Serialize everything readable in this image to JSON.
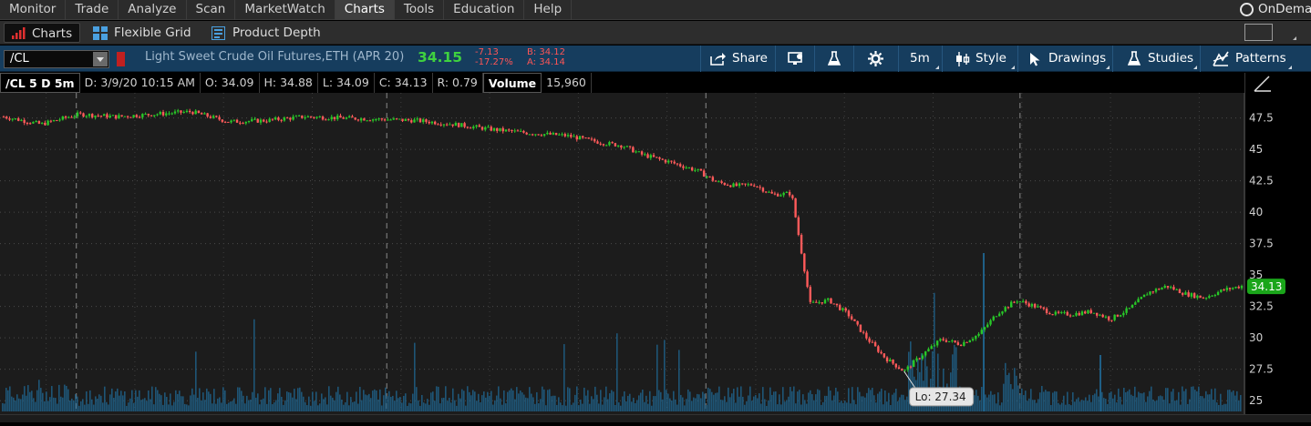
{
  "menubar": {
    "items": [
      "Monitor",
      "Trade",
      "Analyze",
      "Scan",
      "MarketWatch",
      "Charts",
      "Tools",
      "Education",
      "Help"
    ],
    "active": "Charts",
    "ondemand": "OnDemand"
  },
  "subbar": {
    "charts": "Charts",
    "flexible_grid": "Flexible Grid",
    "product_depth": "Product Depth"
  },
  "toolbar": {
    "symbol": "/CL",
    "description": "Light Sweet Crude Oil Futures,ETH (APR 20)",
    "last": "34.15",
    "net_change": "-7.13",
    "pct_change": "-17.27%",
    "bid": "B: 34.12",
    "ask": "A: 34.14",
    "share": "Share",
    "timeframe": "5m",
    "style": "Style",
    "drawings": "Drawings",
    "studies": "Studies",
    "patterns": "Patterns"
  },
  "infobar": {
    "chart_id": "/CL 5 D 5m",
    "date": "D: 3/9/20 10:15 AM",
    "open": "O: 34.09",
    "high": "H: 34.88",
    "low": "L: 34.09",
    "close": "C: 34.13",
    "range": "R: 0.79",
    "volume_label": "Volume",
    "volume_value": "15,960"
  },
  "chart_data": {
    "type": "candlestick",
    "y_ticks": [
      "47.5",
      "45",
      "42.5",
      "40",
      "37.5",
      "35",
      "32.5",
      "30",
      "27.5",
      "25"
    ],
    "ylim": [
      24,
      49.5
    ],
    "series": [
      {
        "name": "/CL",
        "x": [
          0,
          2,
          4,
          6,
          8,
          10,
          12,
          14,
          16,
          18,
          20,
          22,
          24,
          26,
          28,
          30,
          32,
          33,
          34,
          35.5,
          37,
          38,
          39,
          40,
          41,
          42,
          43,
          44,
          45,
          46,
          47,
          48,
          49,
          50,
          51,
          52,
          53,
          54,
          55,
          56,
          57,
          58,
          59,
          60,
          61,
          62,
          63,
          64,
          65,
          66
        ],
        "y": [
          47.6,
          47.0,
          47.8,
          47.6,
          47.8,
          48.0,
          47.2,
          47.3,
          47.6,
          47.5,
          47.4,
          47.3,
          47.0,
          46.6,
          46.3,
          46.1,
          45.5,
          45.3,
          44.6,
          44.0,
          43.3,
          42.4,
          42.1,
          42.2,
          41.4,
          41.5,
          32.7,
          33.0,
          31.9,
          30.0,
          28.4,
          27.34,
          28.7,
          29.9,
          29.5,
          30.3,
          32.0,
          33.0,
          32.5,
          31.9,
          31.9,
          32.1,
          31.5,
          32.3,
          33.6,
          34.13,
          33.5,
          33.2,
          33.8,
          34.13
        ],
        "last": 34.13,
        "low": 27.34
      }
    ],
    "last_label": "34.13",
    "low_annotation": "Lo: 27.34",
    "grid": true,
    "volume_pane": true,
    "colors": {
      "up": "#28c828",
      "down": "#ff5a5a",
      "volume": "#1f5f86",
      "last_badge": "#1aa51a",
      "tooltip_bg": "#e6e6e6"
    }
  }
}
